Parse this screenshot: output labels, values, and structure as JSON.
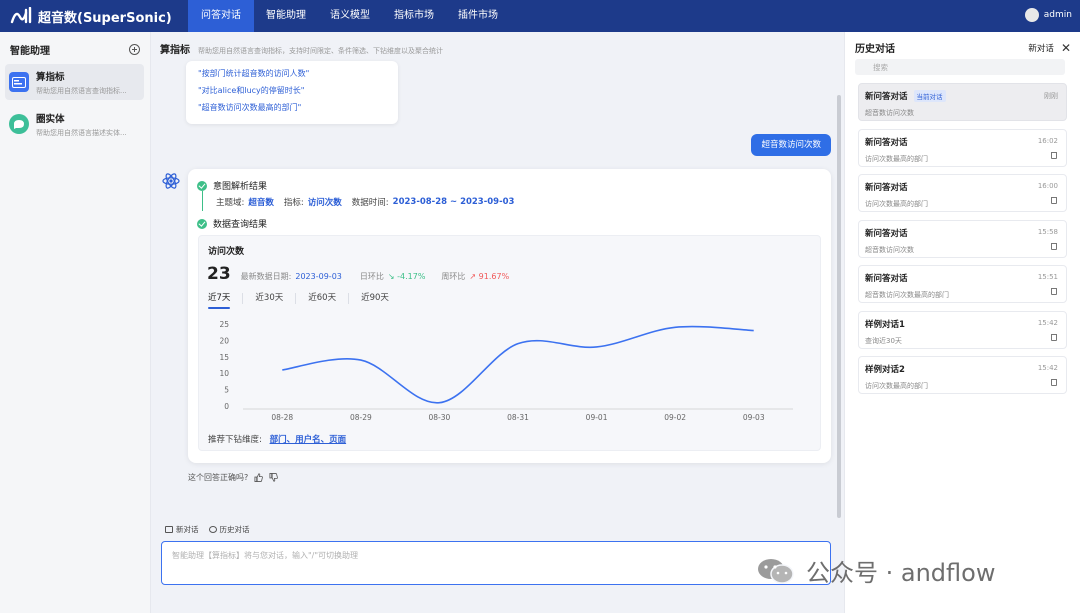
{
  "app": {
    "name": "超音数(SuperSonic)",
    "user": "admin"
  },
  "nav": {
    "items": [
      {
        "label": "问答对话",
        "active": true
      },
      {
        "label": "智能助理",
        "active": false
      },
      {
        "label": "语义模型",
        "active": false
      },
      {
        "label": "指标市场",
        "active": false
      },
      {
        "label": "插件市场",
        "active": false
      }
    ]
  },
  "sidebar": {
    "title": "智能助理",
    "items": [
      {
        "name": "算指标",
        "desc": "帮助您用自然语言查询指标...",
        "active": true,
        "icon": "metric-card-icon"
      },
      {
        "name": "圈实体",
        "desc": "帮助您用自然语言描述实体...",
        "active": false,
        "icon": "entity-chat-icon"
      }
    ]
  },
  "main": {
    "title": "算指标",
    "subtitle": "帮助您用自然语言查询指标，支持时间限定、条件筛选、下钻维度以及聚合统计",
    "tips": [
      "\"按部门统计超音数的访问人数\"",
      "\"对比alice和lucy的停留时长\"",
      "\"超音数访问次数最高的部门\""
    ],
    "user_message": "超音数访问次数",
    "answer": {
      "step1": "意图解析结果",
      "parse": {
        "domain_label": "主题域:",
        "domain_value": "超音数",
        "metric_label": "指标:",
        "metric_value": "访问次数",
        "time_label": "数据时间:",
        "time_value": "2023-08-28 ~ 2023-09-03"
      },
      "step2": "数据查询结果",
      "result": {
        "title": "访问次数",
        "value": "23",
        "latest_date_label": "最新数据日期:",
        "latest_date": "2023-09-03",
        "dod_label": "日环比",
        "dod_value": "↘ -4.17%",
        "wow_label": "周环比",
        "wow_value": "↗ 91.67%",
        "tabs": [
          "近7天",
          "近30天",
          "近60天",
          "近90天"
        ],
        "active_tab": 0,
        "drill_label": "推荐下钻维度:",
        "drill_value": "部门、用户名、页面"
      }
    },
    "feedback": "这个回答正确吗?",
    "bottom_tabs": [
      "新对话",
      "历史对话"
    ],
    "input_placeholder": "智能助理【算指标】将与您对话，输入\"/\"可切换助理"
  },
  "chart_data": {
    "type": "line",
    "categories": [
      "08-28",
      "08-29",
      "08-30",
      "08-31",
      "09-01",
      "09-02",
      "09-03"
    ],
    "values": [
      11,
      14,
      1,
      19,
      18,
      24,
      23
    ],
    "ylim": [
      0,
      25
    ],
    "yticks": [
      0,
      5,
      10,
      15,
      20,
      25
    ],
    "grid": false,
    "color": "#3c72f0"
  },
  "history": {
    "title": "历史对话",
    "new_label": "新对话",
    "search_placeholder": "搜索",
    "items": [
      {
        "name": "新问答对话",
        "badge": "当前对话",
        "time": "刚刚",
        "sub": "超音数访问次数",
        "active": true
      },
      {
        "name": "新问答对话",
        "badge": "",
        "time": "16:02",
        "sub": "访问次数最高的部门",
        "active": false
      },
      {
        "name": "新问答对话",
        "badge": "",
        "time": "16:00",
        "sub": "访问次数最高的部门",
        "active": false
      },
      {
        "name": "新问答对话",
        "badge": "",
        "time": "15:58",
        "sub": "超音数访问次数",
        "active": false
      },
      {
        "name": "新问答对话",
        "badge": "",
        "time": "15:51",
        "sub": "超音数访问次数最高的部门",
        "active": false
      },
      {
        "name": "样例对话1",
        "badge": "",
        "time": "15:42",
        "sub": "查询近30天",
        "active": false
      },
      {
        "name": "样例对话2",
        "badge": "",
        "time": "15:42",
        "sub": "访问次数最高的部门",
        "active": false
      }
    ]
  },
  "watermark": "公众号 · andflow"
}
